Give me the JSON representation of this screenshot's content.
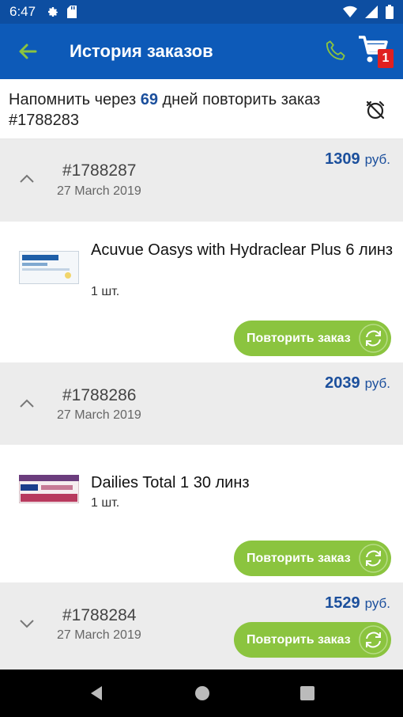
{
  "status_bar": {
    "time": "6:47"
  },
  "app_bar": {
    "title": "История заказов",
    "cart_count": "1"
  },
  "reminder": {
    "prefix": "Напомнить через ",
    "days": "69",
    "suffix": " дней повторить заказ #1788283"
  },
  "orders": [
    {
      "number": "#1788287",
      "date": "27 March 2019",
      "price": "1309",
      "currency": "руб.",
      "expanded": true,
      "item": {
        "name": "Acuvue Oasys with Hydraclear Plus 6 линз",
        "qty": "1 шт."
      },
      "repeat_label": "Повторить заказ"
    },
    {
      "number": "#1788286",
      "date": "27 March 2019",
      "price": "2039",
      "currency": "руб.",
      "expanded": true,
      "item": {
        "name": "Dailies Total 1 30 линз",
        "qty": "1 шт."
      },
      "repeat_label": "Повторить заказ"
    },
    {
      "number": "#1788284",
      "date": "27 March 2019",
      "price": "1529",
      "currency": "руб.",
      "expanded": false,
      "repeat_label": "Повторить заказ"
    }
  ],
  "colors": {
    "primary": "#0d5ab8",
    "accent_green": "#8bc43f",
    "price_blue": "#1b4f9c"
  }
}
